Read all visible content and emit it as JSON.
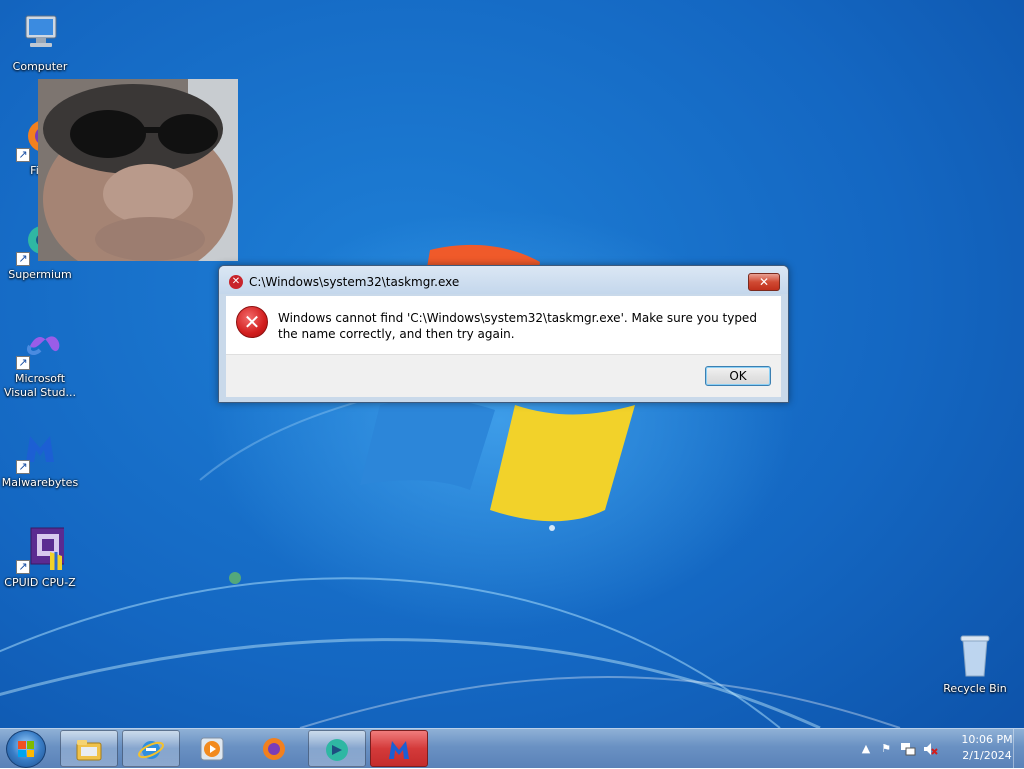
{
  "desktop": {
    "icons": [
      {
        "label": "Computer"
      },
      {
        "label": "Fire"
      },
      {
        "label": "Supermium"
      },
      {
        "label": "Microsoft Visual Stud..."
      },
      {
        "label": "Malwarebytes"
      },
      {
        "label": "CPUID CPU-Z"
      },
      {
        "label": "Recycle Bin"
      }
    ]
  },
  "dialog": {
    "title": "C:\\Windows\\system32\\taskmgr.exe",
    "message": "Windows cannot find 'C:\\Windows\\system32\\taskmgr.exe'. Make sure you typed the name correctly, and then try again.",
    "ok_label": "OK",
    "close_glyph": "✕"
  },
  "taskbar": {
    "pinned": [
      {
        "icon": "file-explorer-icon"
      },
      {
        "icon": "internet-explorer-icon"
      },
      {
        "icon": "media-player-icon"
      },
      {
        "icon": "firefox-icon"
      },
      {
        "icon": "supermium-icon"
      },
      {
        "icon": "malwarebytes-icon"
      }
    ],
    "clock": {
      "time": "10:06 PM",
      "date": "2/1/2024"
    }
  },
  "colors": {
    "desktop_blue": "#1467c2",
    "error_red": "#d21e1e",
    "taskbar_blue": "#6a91c3"
  }
}
